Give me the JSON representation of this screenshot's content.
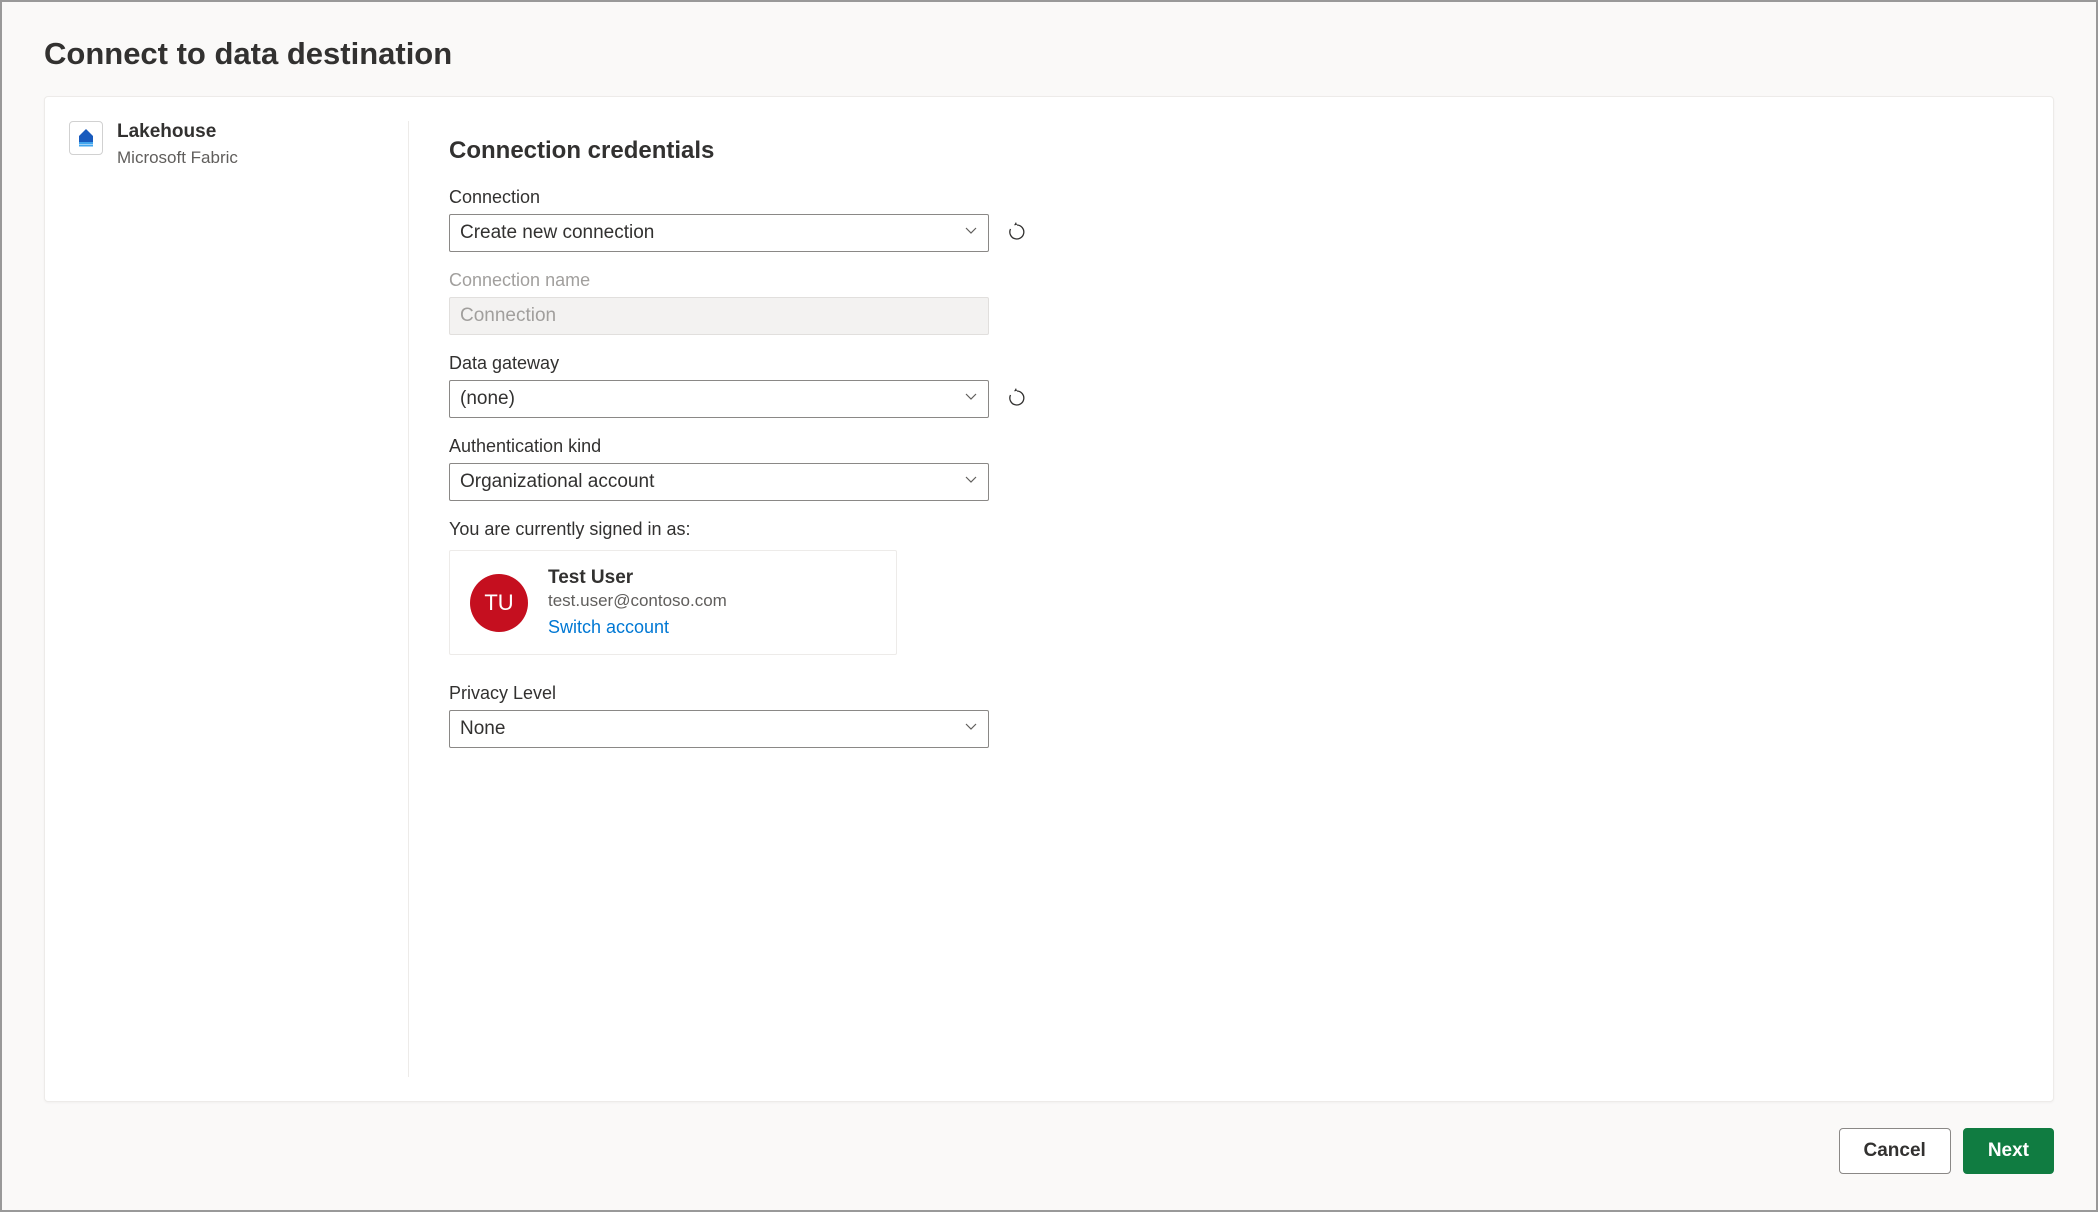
{
  "header": {
    "title": "Connect to data destination"
  },
  "sidebar": {
    "destination_name": "Lakehouse",
    "destination_provider": "Microsoft Fabric"
  },
  "main": {
    "section_title": "Connection credentials",
    "connection": {
      "label": "Connection",
      "value": "Create new connection"
    },
    "connection_name": {
      "label": "Connection name",
      "placeholder": "Connection"
    },
    "data_gateway": {
      "label": "Data gateway",
      "value": "(none)"
    },
    "auth_kind": {
      "label": "Authentication kind",
      "value": "Organizational account"
    },
    "signed_in_label": "You are currently signed in as:",
    "account": {
      "initials": "TU",
      "name": "Test User",
      "email": "test.user@contoso.com",
      "switch_label": "Switch account"
    },
    "privacy": {
      "label": "Privacy Level",
      "value": "None"
    }
  },
  "footer": {
    "cancel_label": "Cancel",
    "next_label": "Next"
  }
}
